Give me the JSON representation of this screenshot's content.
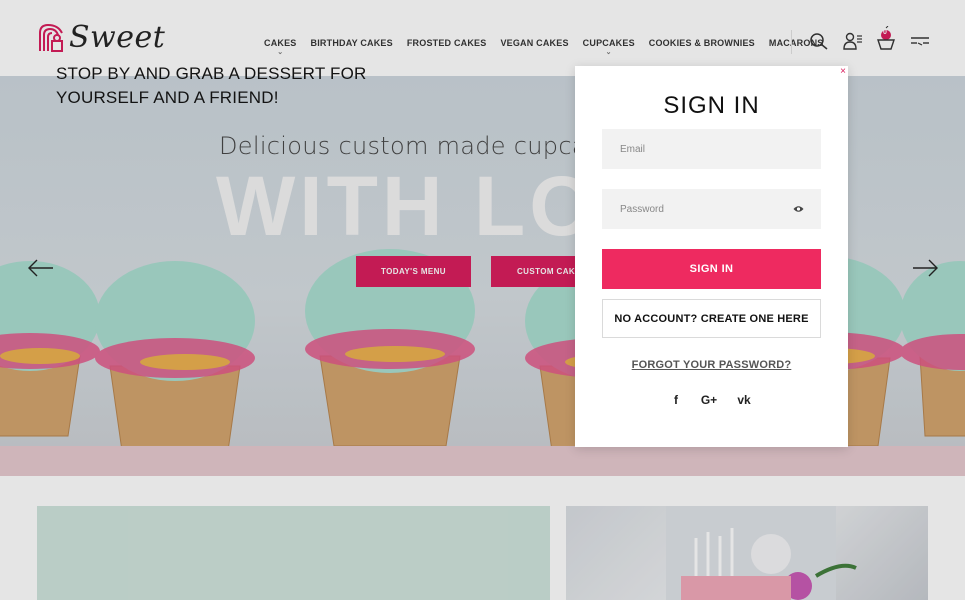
{
  "brand": {
    "logo_text": "Sweet"
  },
  "nav": {
    "items": [
      {
        "label": "CAKES",
        "has_dropdown": true
      },
      {
        "label": "BIRTHDAY CAKES",
        "has_dropdown": false
      },
      {
        "label": "FROSTED CAKES",
        "has_dropdown": false
      },
      {
        "label": "VEGAN CAKES",
        "has_dropdown": false
      },
      {
        "label": "CUPCAKES",
        "has_dropdown": true
      },
      {
        "label": "COOKIES & BROWNIES",
        "has_dropdown": false
      },
      {
        "label": "MACARONS",
        "has_dropdown": false
      }
    ],
    "caret": "⌄"
  },
  "header_icons": {
    "search": "search-icon",
    "account": "user-list-icon",
    "cart": "cupcake-cart-icon",
    "cart_count": "0",
    "menu": "menu-icon"
  },
  "hero": {
    "subtitle": "Delicious custom made cupcakes,",
    "headline": "WITH LO",
    "buttons": [
      "TODAY'S MENU",
      "CUSTOM CAKES"
    ]
  },
  "promo": {
    "title_line1": "STOP BY AND GRAB A DESSERT FOR",
    "title_line2": "YOURSELF AND A FRIEND!"
  },
  "signin": {
    "title": "SIGN IN",
    "close": "×",
    "email_placeholder": "Email",
    "password_placeholder": "Password",
    "submit_label": "SIGN IN",
    "create_label": "NO ACCOUNT? CREATE ONE HERE",
    "forgot_label": "FORGOT YOUR PASSWORD?",
    "social": [
      "f",
      "G+",
      "vk"
    ]
  },
  "colors": {
    "accent": "#ee2a60",
    "hero_button": "#d91a5a",
    "promo_bg": "#cfe4dc",
    "field_bg": "#f2f2f2"
  }
}
